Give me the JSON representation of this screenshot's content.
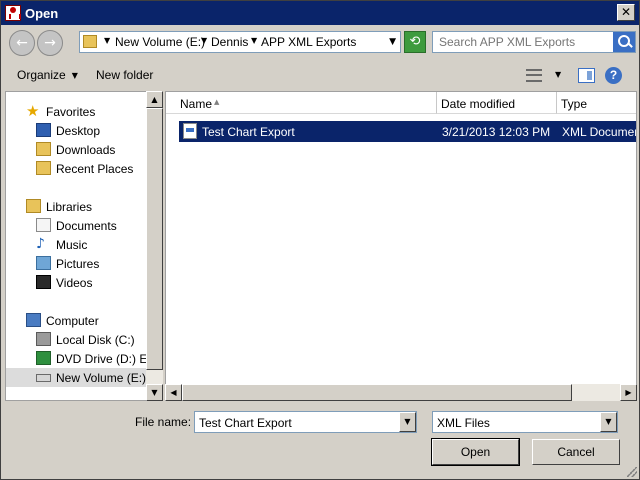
{
  "window": {
    "title": "Open",
    "close_glyph": "✕"
  },
  "navigation": {
    "back_glyph": "←",
    "forward_glyph": "→",
    "refresh_glyph": "⟲",
    "breadcrumbs": [
      "New Volume (E:)",
      "Dennis",
      "APP XML Exports"
    ],
    "search_placeholder": "Search APP XML Exports"
  },
  "toolbar": {
    "organize_label": "Organize",
    "new_folder_label": "New folder",
    "help_label": "?"
  },
  "sidebar": {
    "items": [
      {
        "label": "Favorites",
        "icon": "star-icon",
        "kind": "heading"
      },
      {
        "label": "Desktop",
        "icon": "desktop-icon",
        "kind": "child"
      },
      {
        "label": "Downloads",
        "icon": "downloads-folder-icon",
        "kind": "child"
      },
      {
        "label": "Recent Places",
        "icon": "recent-places-icon",
        "kind": "child"
      },
      {
        "label": "Libraries",
        "icon": "libraries-icon",
        "kind": "heading"
      },
      {
        "label": "Documents",
        "icon": "documents-icon",
        "kind": "child"
      },
      {
        "label": "Music",
        "icon": "music-note-icon",
        "kind": "child"
      },
      {
        "label": "Pictures",
        "icon": "pictures-icon",
        "kind": "child"
      },
      {
        "label": "Videos",
        "icon": "videos-icon",
        "kind": "child"
      },
      {
        "label": "Computer",
        "icon": "computer-icon",
        "kind": "heading"
      },
      {
        "label": "Local Disk (C:)",
        "icon": "local-disk-icon",
        "kind": "child"
      },
      {
        "label": "DVD Drive (D:) ENU",
        "icon": "dvd-drive-icon",
        "kind": "child"
      },
      {
        "label": "New Volume (E:)",
        "icon": "volume-drive-icon",
        "kind": "child",
        "selected": true
      }
    ]
  },
  "file_list": {
    "columns": [
      "Name",
      "Date modified",
      "Type"
    ],
    "sort_glyph": "▲",
    "rows": [
      {
        "name": "Test Chart Export",
        "date_modified": "3/21/2013 12:03 PM",
        "type": "XML Document",
        "selected": true
      }
    ]
  },
  "footer": {
    "file_name_label": "File name:",
    "file_name_value": "Test Chart Export",
    "file_type_value": "XML Files",
    "open_label": "Open",
    "cancel_label": "Cancel"
  },
  "colors": {
    "titlebar": "#0a246a",
    "selection": "#0a246a",
    "face": "#d4d0c8"
  }
}
